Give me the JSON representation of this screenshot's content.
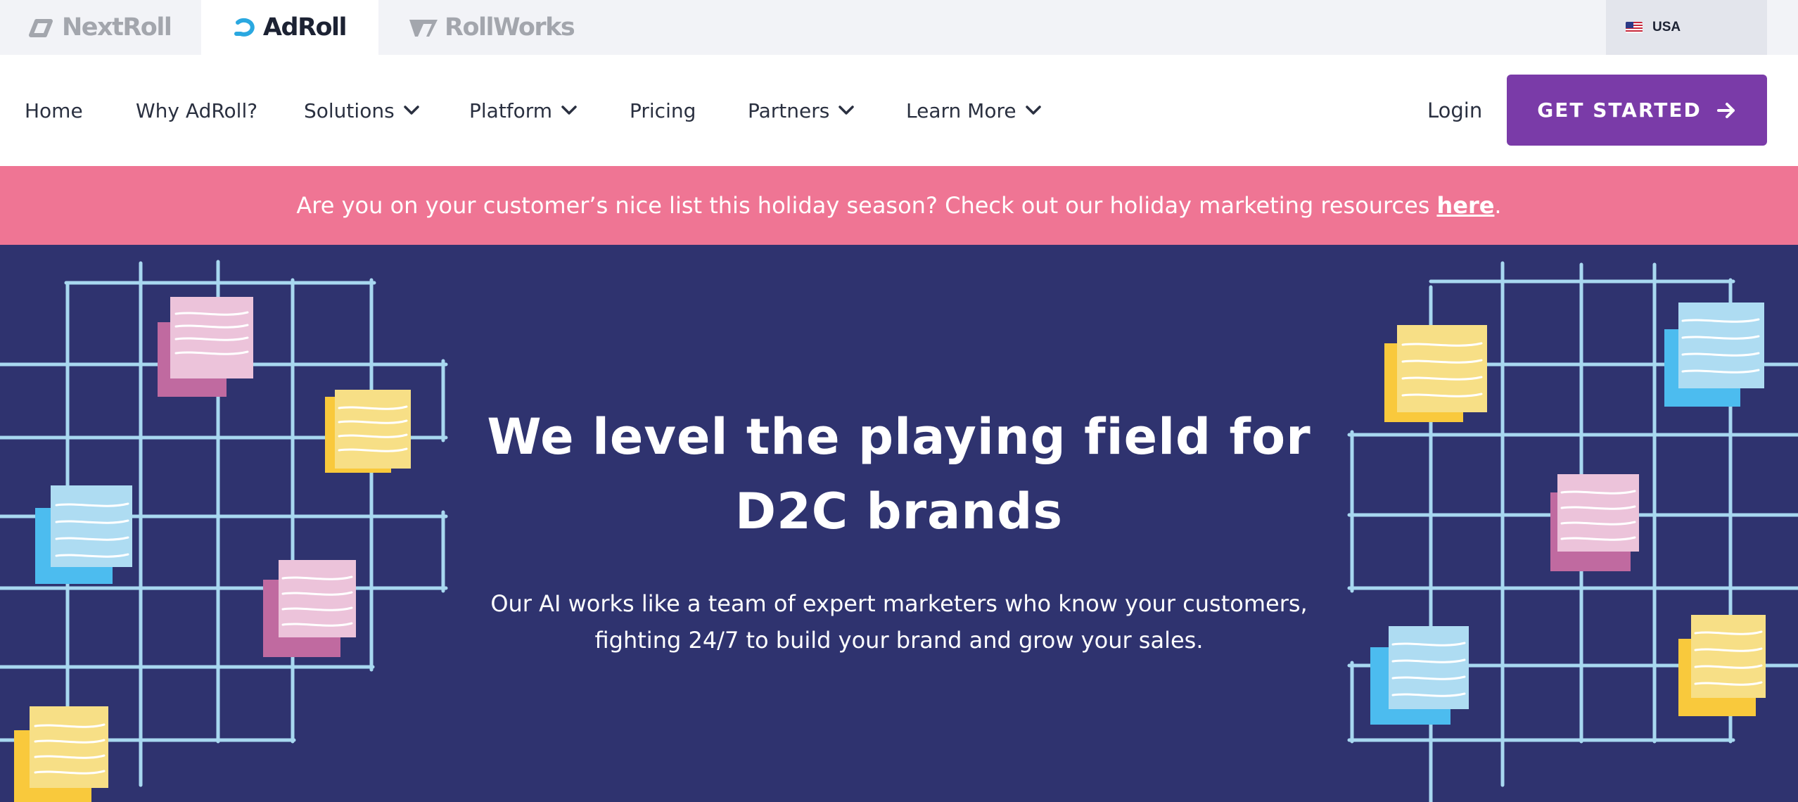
{
  "brands": {
    "nextroll": "NextRoll",
    "adroll": "AdRoll",
    "rollworks": "RollWorks"
  },
  "region": {
    "label": "USA",
    "flag_icon": "us-flag-icon"
  },
  "nav": {
    "items": [
      {
        "label": "Home",
        "dropdown": false
      },
      {
        "label": "Why AdRoll?",
        "dropdown": false
      },
      {
        "label": "Solutions",
        "dropdown": true
      },
      {
        "label": "Platform",
        "dropdown": true
      },
      {
        "label": "Pricing",
        "dropdown": false
      },
      {
        "label": "Partners",
        "dropdown": true
      },
      {
        "label": "Learn More",
        "dropdown": true
      }
    ],
    "login": "Login",
    "cta": "GET STARTED"
  },
  "banner": {
    "text": "Are you on your customer’s nice list this holiday season? Check out our holiday marketing resources",
    "link": "here",
    "end": "."
  },
  "hero": {
    "title_bold": "We level the playing field",
    "title_rest": "for D2C brands",
    "subtitle": "Our AI works like a team of expert marketers who know your customers, fighting 24/7 to build your brand and grow your sales."
  },
  "colors": {
    "primary_purple": "#7a3ba8",
    "banner_pink": "#ef7594",
    "hero_navy": "#2f336f",
    "adroll_blue": "#2aa8e0",
    "grid_blue": "#a8d8f0",
    "note_pink": "#ecc3da",
    "note_yellow": "#f7df86",
    "note_blue": "#aedcf2"
  }
}
